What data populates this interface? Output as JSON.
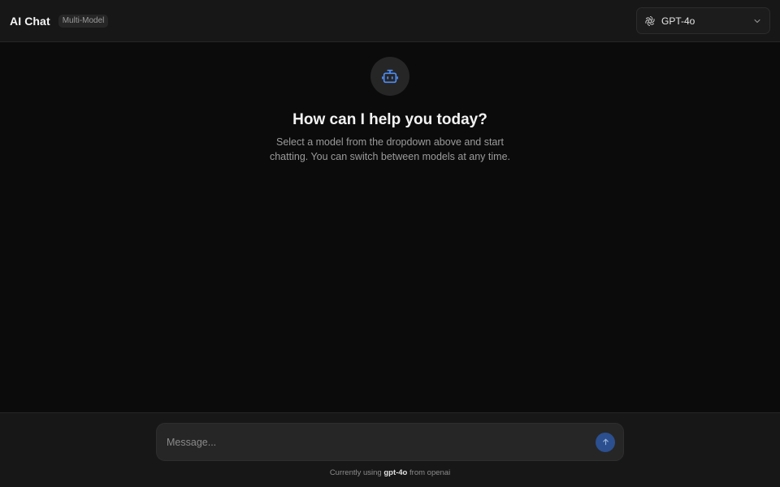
{
  "header": {
    "title": "AI Chat",
    "badge": "Multi-Model",
    "model_selector": {
      "icon": "openai-icon",
      "selected": "GPT-4o",
      "chevron": "chevron-down-icon"
    }
  },
  "empty_state": {
    "icon": "bot-icon",
    "title": "How can I help you today?",
    "subtitle": "Select a model from the dropdown above and start chatting. You can switch between models at any time."
  },
  "composer": {
    "placeholder": "Message...",
    "send_icon": "arrow-up-icon"
  },
  "status": {
    "prefix": "Currently using",
    "model": "gpt-4o",
    "middle": "from",
    "provider": "openai"
  },
  "colors": {
    "background": "#0b0b0b",
    "header": "#171717",
    "accent": "#3b82f6",
    "send_button": "#2b4f8f"
  }
}
